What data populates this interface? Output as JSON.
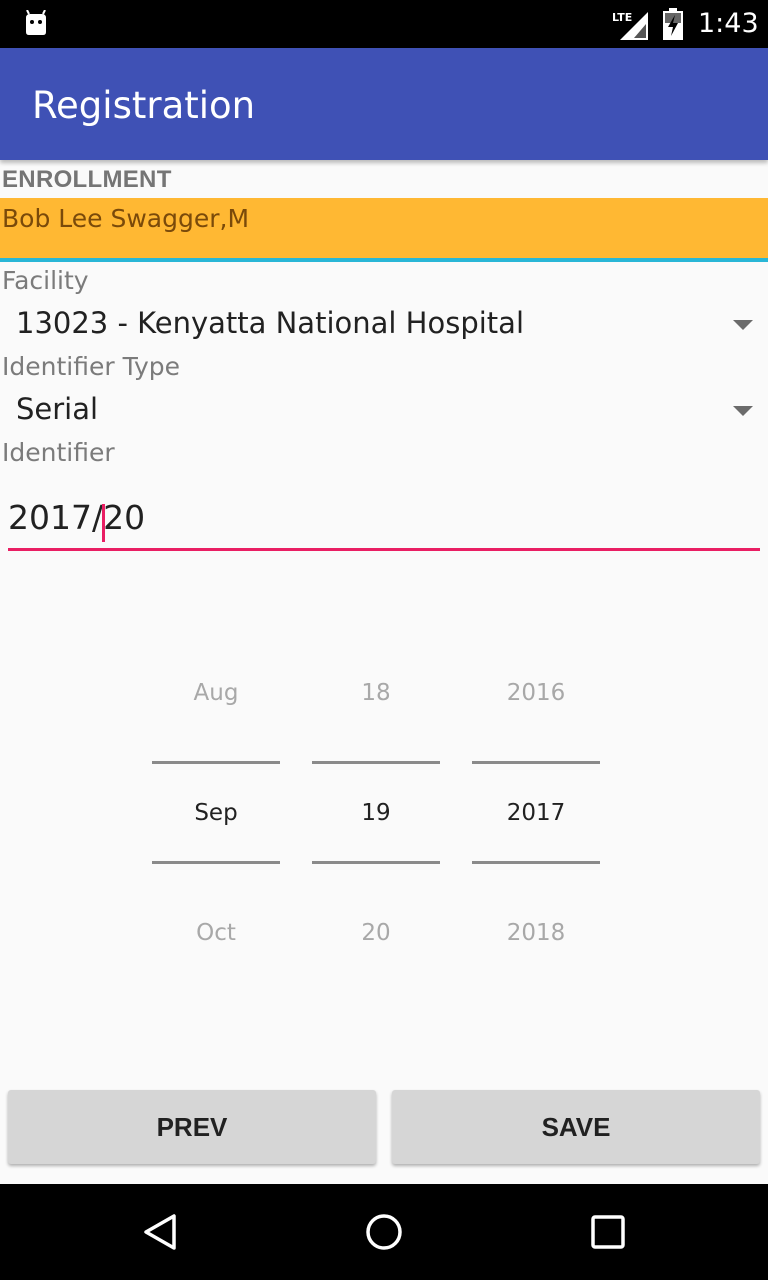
{
  "status_bar": {
    "time": "1:43",
    "network": "LTE",
    "icons": [
      "android-icon",
      "lte-signal-icon",
      "battery-icon"
    ]
  },
  "app_bar": {
    "title": "Registration",
    "color": "#3f51b5"
  },
  "section": {
    "header": "ENROLLMENT"
  },
  "patient": {
    "name": "Bob Lee Swagger,M",
    "highlight_color": "#ffb833"
  },
  "facility": {
    "label": "Facility",
    "value": "13023 - Kenyatta National Hospital"
  },
  "identifier_type": {
    "label": "Identifier Type",
    "value": "Serial"
  },
  "identifier": {
    "label": "Identifier",
    "value": "2017/20",
    "accent_color": "#e91e63"
  },
  "date_picker": {
    "month": {
      "prev": "Aug",
      "selected": "Sep",
      "next": "Oct"
    },
    "day": {
      "prev": "18",
      "selected": "19",
      "next": "20"
    },
    "year": {
      "prev": "2016",
      "selected": "2017",
      "next": "2018"
    }
  },
  "buttons": {
    "prev": "PREV",
    "save": "SAVE"
  },
  "nav_bar": {
    "icons": [
      "back-icon",
      "home-icon",
      "recents-icon"
    ]
  }
}
